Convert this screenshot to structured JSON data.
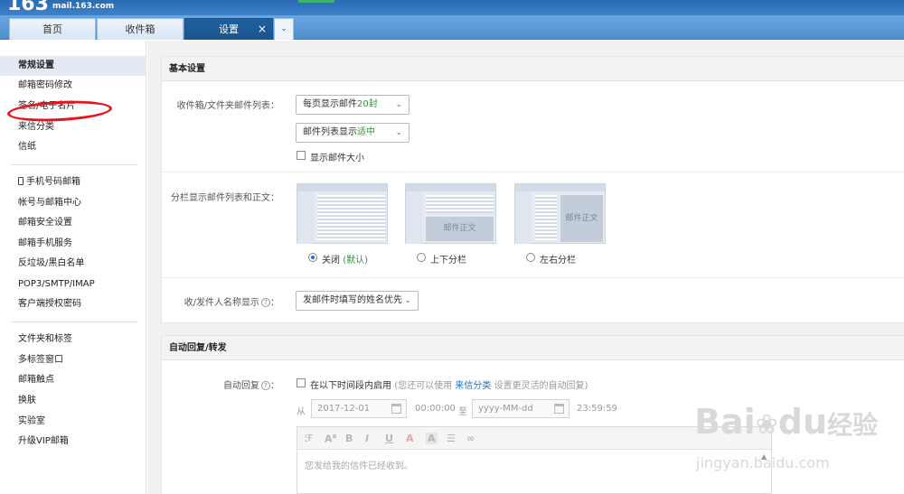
{
  "header": {
    "logo_number": "163",
    "logo_domain": "mail.163.com"
  },
  "tabs": {
    "home": "首页",
    "inbox": "收件箱",
    "settings": "设置",
    "close": "×",
    "more": "⌄"
  },
  "sidebar": {
    "group1": [
      "常规设置",
      "邮箱密码修改",
      "签名/电子名片",
      "来信分类",
      "信纸"
    ],
    "group2": [
      "手机号码邮箱",
      "帐号与邮箱中心",
      "邮箱安全设置",
      "邮箱手机服务",
      "反垃圾/黑白名单",
      "POP3/SMTP/IMAP",
      "客户端授权密码"
    ],
    "group3": [
      "文件夹和标签",
      "多标签窗口",
      "邮箱触点",
      "换肤",
      "实验室",
      "升级VIP邮箱"
    ]
  },
  "basic": {
    "title": "基本设置",
    "list_label": "收件箱/文件夹邮件列表：",
    "per_page_prefix": "每页显示邮件",
    "per_page_value": "20封",
    "list_display_prefix": "邮件列表显示",
    "list_display_value": "适中",
    "show_size_label": "显示邮件大小",
    "split_label": "分栏显示邮件列表和正文：",
    "thumb_body_text": "邮件正文",
    "radio_off": "关闭",
    "radio_off_default": "(默认)",
    "radio_topbottom": "上下分栏",
    "radio_leftright": "左右分栏",
    "name_label": "收/发件人名称显示",
    "name_select": "发邮件时填写的姓名优先"
  },
  "auto_reply": {
    "title": "自动回复/转发",
    "label": "自动回复",
    "enable_label": "在以下时间段内启用",
    "hint_prefix": "(您还可以使用",
    "hint_link": "来信分类",
    "hint_suffix": "设置更灵活的自动回复)",
    "from": "从",
    "start_date": "2017-12-01",
    "start_time": "00:00:00",
    "to": "至",
    "end_date_placeholder": "yyyy-MM-dd",
    "end_time": "23:59:59",
    "editor_text": "您发给我的信件已经收到。"
  },
  "icons": {
    "help": "?",
    "question_mark": "?"
  },
  "watermark": {
    "brand": "Bai",
    "brand_cn": "经验",
    "url": "jingyan.baidu.com"
  },
  "colors": {
    "brand_blue": "#2a6bb5",
    "active_tab": "#1f5f9f",
    "highlight_green": "#2a9c2a",
    "annotation_red": "#e8141b"
  }
}
